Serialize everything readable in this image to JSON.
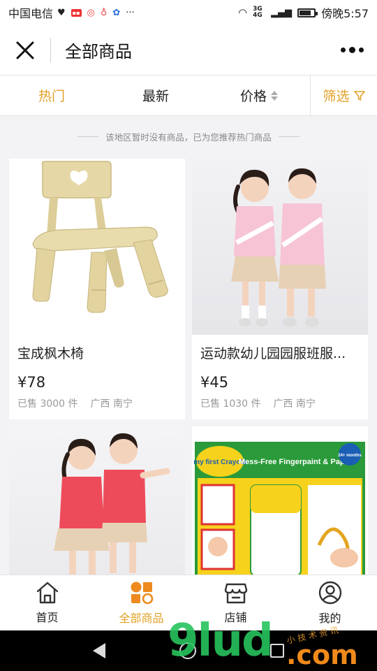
{
  "status_bar": {
    "carrier": "中国电信",
    "more": "···",
    "network": "3G 4G",
    "time": "傍晚5:57",
    "battery_level": 0.8
  },
  "header": {
    "title": "全部商品"
  },
  "sort_bar": {
    "tabs": [
      "热门",
      "最新",
      "价格"
    ],
    "filter_label": "筛选",
    "active_tab": "热门"
  },
  "notice": "该地区暂时没有商品，已为您推荐热门商品",
  "products": [
    {
      "name": "宝成枫木椅",
      "price": "¥78",
      "sold": "已售 3000 件",
      "location": "广西 南宁"
    },
    {
      "name": "运动款幼儿园园服班服...",
      "price": "¥45",
      "sold": "已售 1030 件",
      "location": "广西 南宁"
    },
    {
      "name": "",
      "price": "",
      "sold": "",
      "location": ""
    },
    {
      "name": "",
      "price": "",
      "sold": "",
      "location": ""
    }
  ],
  "product_image_text": {
    "crayola_brand": "my first Crayola",
    "crayola_product": "Mess-Free Fingerpaint & Paper",
    "crayola_age": "24+ months"
  },
  "bottom_nav": [
    {
      "label": "首页",
      "icon": "home-icon"
    },
    {
      "label": "全部商品",
      "icon": "grid-icon",
      "active": true
    },
    {
      "label": "店铺",
      "icon": "store-icon"
    },
    {
      "label": "我的",
      "icon": "user-icon"
    }
  ],
  "watermark": {
    "text": "9lud",
    "suffix": ".com",
    "small": "小 技 术 资 讯"
  },
  "colors": {
    "accent": "#e2a024"
  }
}
